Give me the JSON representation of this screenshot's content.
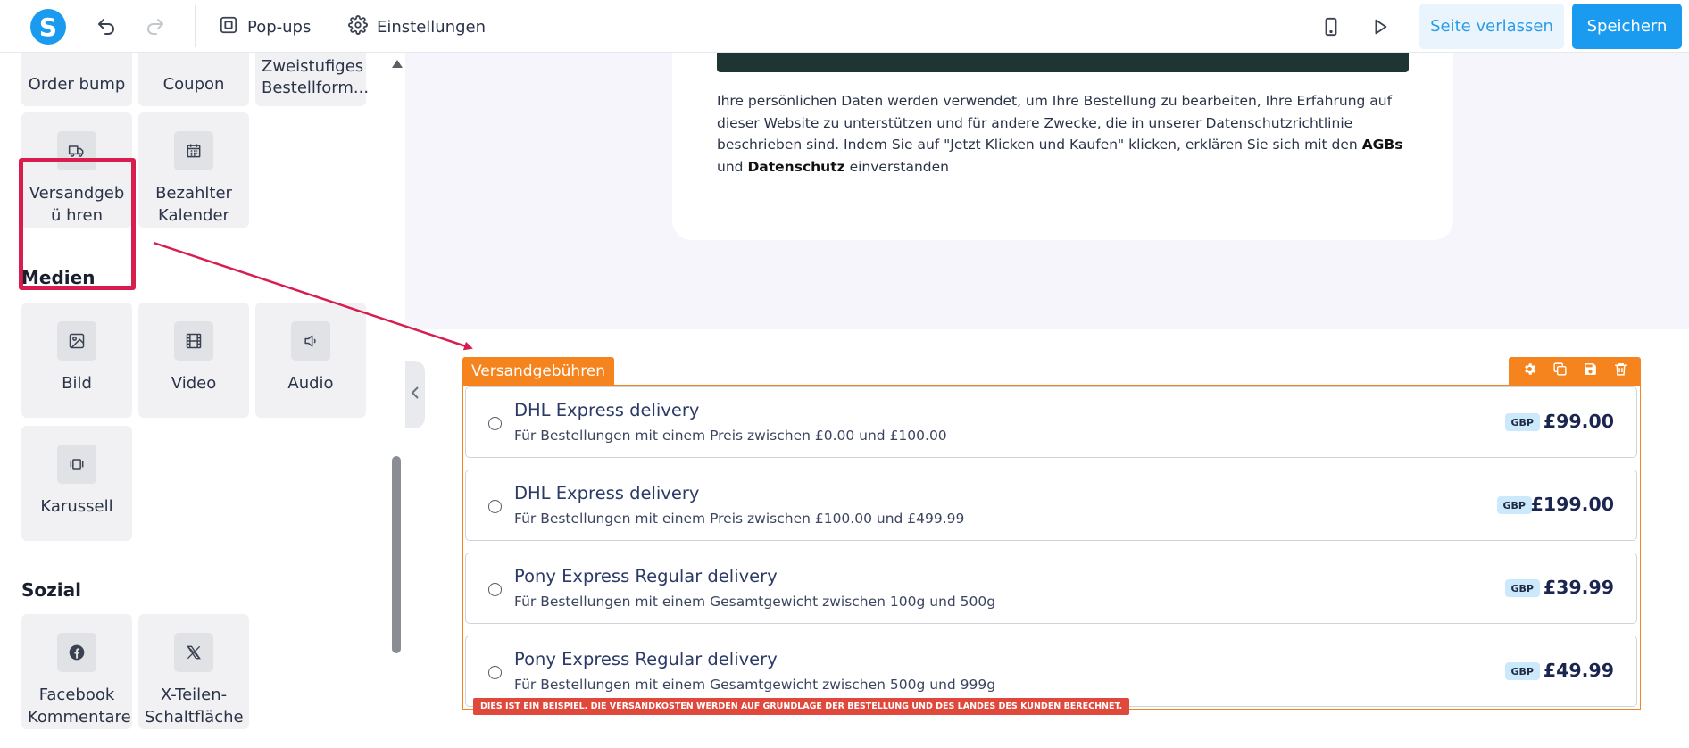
{
  "topbar": {
    "logo_letter": "S",
    "popups_label": "Pop-ups",
    "settings_label": "Einstellungen",
    "leave_label": "Seite verlassen",
    "save_label": "Speichern"
  },
  "sidebar": {
    "row0": [
      {
        "label": "Order bump"
      },
      {
        "label": "Coupon"
      },
      {
        "label": "Zweistufiges Bestellform..."
      }
    ],
    "row1": [
      {
        "label": "Versandgebü hren",
        "icon": "truck-icon"
      },
      {
        "label": "Bezahlter Kalender",
        "icon": "calendar-icon"
      }
    ],
    "media_title": "Medien",
    "media": [
      {
        "label": "Bild",
        "icon": "image-icon"
      },
      {
        "label": "Video",
        "icon": "video-icon"
      },
      {
        "label": "Audio",
        "icon": "audio-icon"
      },
      {
        "label": "Karussell",
        "icon": "carousel-icon"
      }
    ],
    "social_title": "Sozial",
    "social": [
      {
        "label": "Facebook Kommentare",
        "icon": "facebook-icon"
      },
      {
        "label": "X-Teilen-Schaltfläche",
        "icon": "x-icon"
      }
    ]
  },
  "canvas": {
    "privacy_text_1": "Ihre persönlichen Daten werden verwendet, um Ihre Bestellung zu bearbeiten, Ihre Erfahrung auf dieser Website zu unterstützen und für andere Zwecke, die in unserer Datenschutzrichtlinie beschrieben sind. Indem Sie auf \"Jetzt Klicken und Kaufen\" klicken, erklären Sie sich mit den",
    "agb": "AGBs",
    "and": "und",
    "datenschutz": "Datenschutz",
    "einverstanden": "einverstanden",
    "shipping_label": "Versandgebühren",
    "shipping_rows": [
      {
        "name": "DHL Express delivery",
        "desc": "Für Bestellungen mit einem Preis zwischen £0.00 und £100.00",
        "currency": "GBP",
        "price": "£99.00"
      },
      {
        "name": "DHL Express delivery",
        "desc": "Für Bestellungen mit einem Preis zwischen £100.00 und £499.99",
        "currency": "GBP",
        "price": "£199.00"
      },
      {
        "name": "Pony Express Regular delivery",
        "desc": "Für Bestellungen mit einem Gesamtgewicht zwischen 100g und 500g",
        "currency": "GBP",
        "price": "£39.99"
      },
      {
        "name": "Pony Express Regular delivery",
        "desc": "Für Bestellungen mit einem Gesamtgewicht zwischen 500g und 999g",
        "currency": "GBP",
        "price": "£49.99"
      }
    ],
    "note": "DIES IST EIN BEISPIEL. DIE VERSANDKOSTEN WERDEN AUF GRUNDLAGE DER BESTELLUNG UND DES LANDES DES KUNDEN BERECHNET."
  },
  "colors": {
    "accent": "#1a9bf0",
    "orange": "#f5841f",
    "highlight": "#d81e4e"
  }
}
